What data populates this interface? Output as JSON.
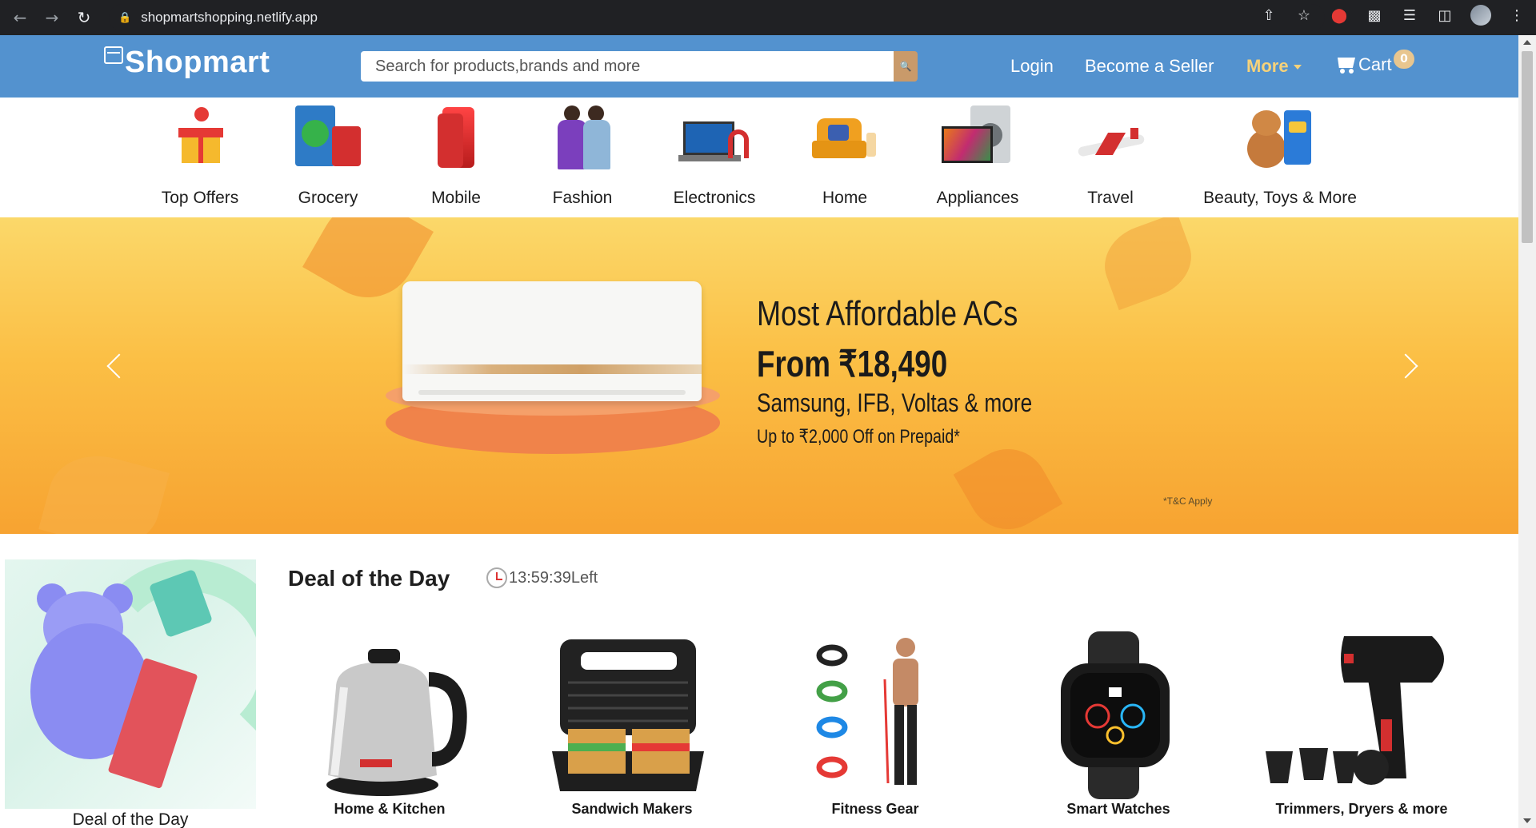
{
  "browser": {
    "url": "shopmartshopping.netlify.app",
    "back_icon": "arrow-left-icon",
    "forward_icon": "arrow-right-icon",
    "reload_icon": "reload-icon"
  },
  "header": {
    "logo_text": "Shopmart",
    "search_placeholder": "Search for products,brands and more",
    "login": "Login",
    "become_seller": "Become a Seller",
    "more": "More",
    "cart": "Cart",
    "cart_count": "0"
  },
  "categories": [
    {
      "label": "Top Offers"
    },
    {
      "label": "Grocery"
    },
    {
      "label": "Mobile"
    },
    {
      "label": "Fashion"
    },
    {
      "label": "Electronics"
    },
    {
      "label": "Home"
    },
    {
      "label": "Appliances"
    },
    {
      "label": "Travel"
    },
    {
      "label": "Beauty, Toys & More"
    }
  ],
  "banner": {
    "line1": "Most Affordable ACs",
    "line2": "From ₹18,490",
    "line3": "Samsung, IFB, Voltas & more",
    "line4": "Up to ₹2,000 Off on Prepaid*",
    "tnc": "*T&C Apply"
  },
  "deal": {
    "title": "Deal of the Day",
    "timer": "13:59:39Left",
    "card_label": "Deal of the Day",
    "products": [
      {
        "label": "Home & Kitchen"
      },
      {
        "label": "Sandwich Makers"
      },
      {
        "label": "Fitness Gear"
      },
      {
        "label": "Smart Watches"
      },
      {
        "label": "Trimmers, Dryers & more"
      }
    ]
  },
  "colors": {
    "header_bg": "#5392cf",
    "accent_more": "#f6d27a",
    "search_button": "#c99a6a",
    "banner_top": "#fbd86a",
    "banner_bottom": "#f7a331"
  }
}
